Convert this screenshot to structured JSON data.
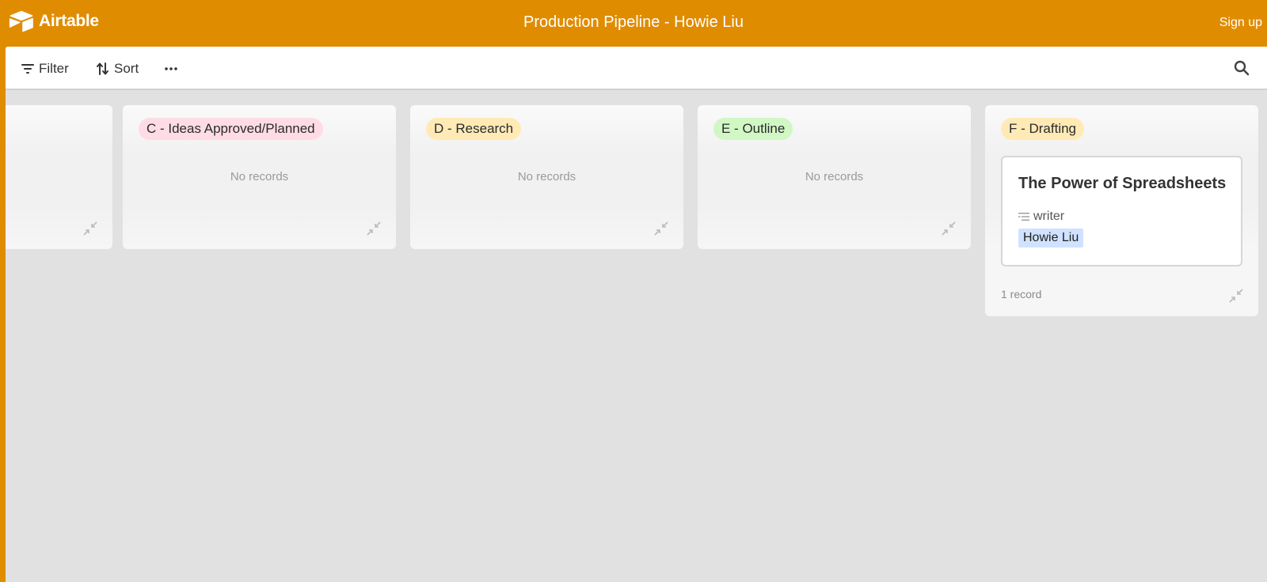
{
  "header": {
    "logo_text": "Airtable",
    "title": "Production Pipeline - Howie Liu",
    "signup_label": "Sign up"
  },
  "toolbar": {
    "filter_label": "Filter",
    "sort_label": "Sort",
    "more_icon": "more-horizontal-icon",
    "search_icon": "search-icon"
  },
  "columns": [
    {
      "label": "",
      "color": "#f1f1f1",
      "empty_text": "",
      "records": []
    },
    {
      "label": "C - Ideas Approved/Planned",
      "color": "#ffdce5",
      "empty_text": "No records",
      "records": []
    },
    {
      "label": "D - Research",
      "color": "#ffeab6",
      "empty_text": "No records",
      "records": []
    },
    {
      "label": "E - Outline",
      "color": "#d1f7c4",
      "empty_text": "No records",
      "records": []
    },
    {
      "label": "F - Drafting",
      "color": "#ffeab6",
      "empty_text": "",
      "record_count": "1 record",
      "records": [
        {
          "title": "The Power of Spreadsheets",
          "field_label": "writer",
          "field_value": "Howie Liu"
        }
      ]
    }
  ],
  "colors": {
    "brand": "#e08c00",
    "board_bg": "#e1e1e1",
    "chip_bg": "#d0e2ff"
  }
}
